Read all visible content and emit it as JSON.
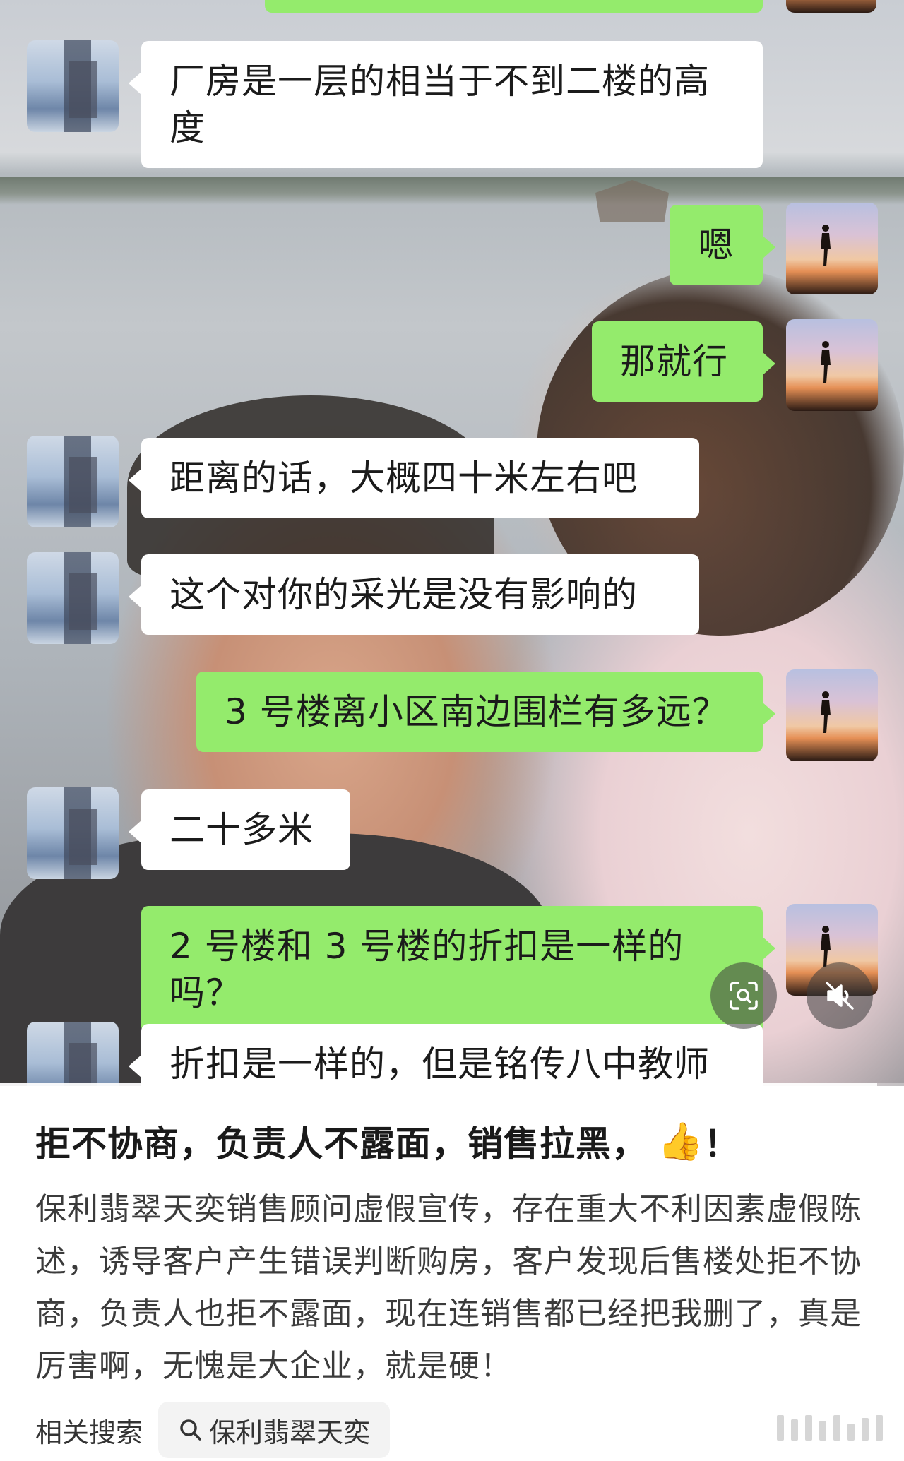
{
  "chat": {
    "messages": [
      {
        "side": "left",
        "text": "厂房是一层的相当于不到二楼的高\n度"
      },
      {
        "side": "right",
        "text": "嗯"
      },
      {
        "side": "right",
        "text": "那就行"
      },
      {
        "side": "left",
        "text": "距离的话，大概四十米左右吧"
      },
      {
        "side": "left",
        "text": "这个对你的采光是没有影响的"
      },
      {
        "side": "right",
        "text": "3 号楼离小区南边围栏有多远？"
      },
      {
        "side": "left",
        "text": "二十多米"
      },
      {
        "side": "right",
        "text": "2 号楼和 3 号楼的折扣是一样的吗？"
      },
      {
        "side": "left",
        "text": "折扣是一样的，但是铭传八中教师"
      }
    ]
  },
  "video": {
    "progress": 0.97,
    "icons": [
      "scan-icon",
      "mute-icon"
    ]
  },
  "post": {
    "title": "拒不协商，负责人不露面，销售拉黑，",
    "title_emoji": "👍",
    "title_end": "！",
    "body": "保利翡翠天奕销售顾问虚假宣传，存在重大不利因素虚假陈述，诱导客户产生错误判断购房，客户发现后售楼处拒不协商，负责人也拒不露面，现在连销售都已经把我删了，真是厉害啊，无愧是大企业，就是硬！"
  },
  "related": {
    "label": "相关搜索",
    "query": "保利翡翠天奕"
  },
  "colors": {
    "bubble_green": "#94eb6c",
    "bubble_white": "#ffffff"
  }
}
